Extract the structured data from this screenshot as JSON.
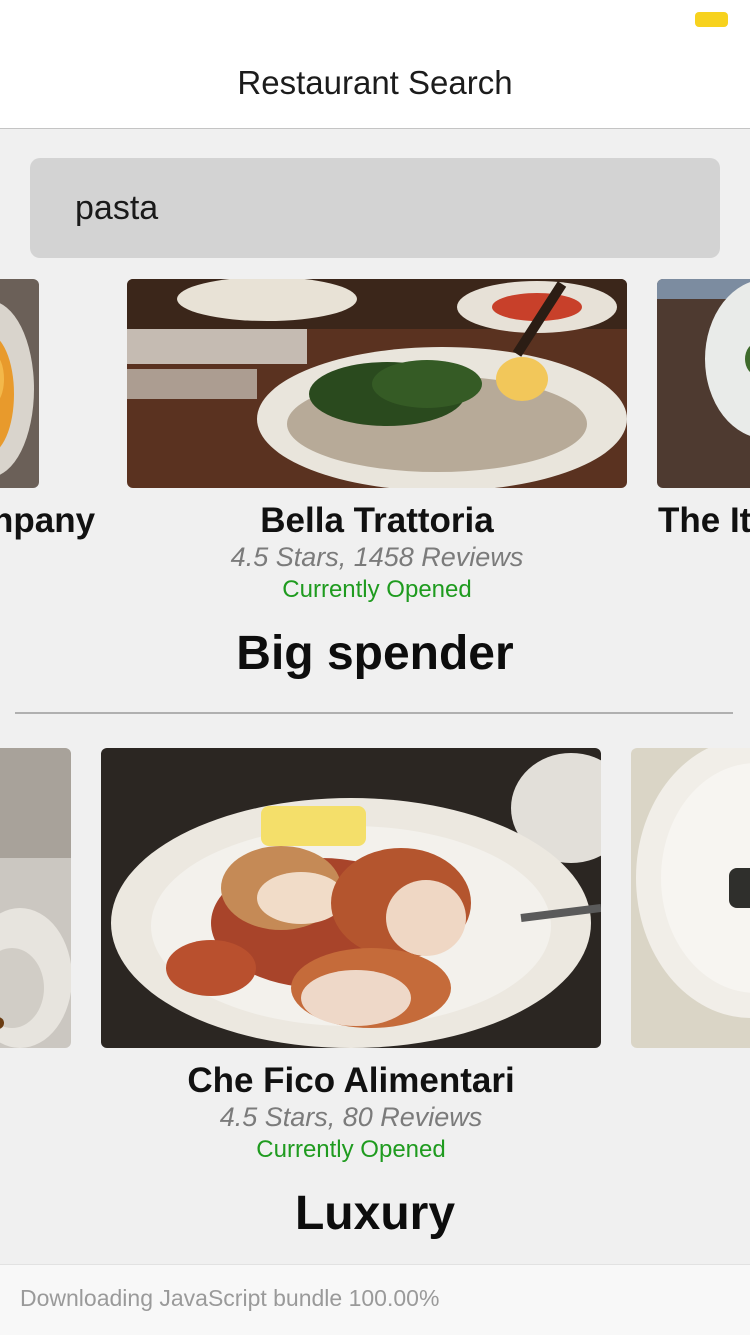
{
  "nav": {
    "title": "Restaurant Search"
  },
  "search": {
    "value": "pasta"
  },
  "row1": {
    "left_name_partial": "npany",
    "center": {
      "name": "Bella Trattoria",
      "meta": "4.5 Stars, 1458 Reviews",
      "status": "Currently Opened"
    },
    "right_name_partial": "The It"
  },
  "sections": {
    "big_spender": "Big spender",
    "luxury": "Luxury"
  },
  "row2": {
    "center": {
      "name": "Che Fico Alimentari",
      "meta": "4.5 Stars, 80 Reviews",
      "status": "Currently Opened"
    }
  },
  "footer": {
    "text": "Downloading JavaScript bundle 100.00%"
  },
  "colors": {
    "battery": "#f7d21e",
    "status_open": "#1f9b1f",
    "search_bg": "#d3d3d3"
  }
}
